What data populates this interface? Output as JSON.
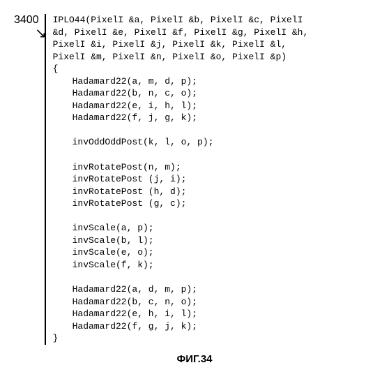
{
  "label": "3400",
  "caption": "ФИГ.34",
  "code": {
    "sig1": "IPLO44(PixelI &a, PixelI &b, PixelI &c, PixelI",
    "sig2": "&d, PixelI &e, PixelI &f, PixelI &g, PixelI &h,",
    "sig3": "PixelI &i, PixelI &j, PixelI &k, PixelI &l,",
    "sig4": "PixelI &m, PixelI &n, PixelI &o, PixelI &p)",
    "brace_open": "{",
    "h1": "Hadamard22(a, m, d, p);",
    "h2": "Hadamard22(b, n, c, o);",
    "h3": "Hadamard22(e, i, h, l);",
    "h4": "Hadamard22(f, j, g, k);",
    "iop": "invOddOddPost(k, l, o, p);",
    "r1": "invRotatePost(n, m);",
    "r2": "invRotatePost (j, i);",
    "r3": "invRotatePost (h, d);",
    "r4": "invRotatePost (g, c);",
    "s1": "invScale(a, p);",
    "s2": "invScale(b, l);",
    "s3": "invScale(e, o);",
    "s4": "invScale(f, k);",
    "hb1": "Hadamard22(a, d, m, p);",
    "hb2": "Hadamard22(b, c, n, o);",
    "hb3": "Hadamard22(e, h, i, l);",
    "hb4": "Hadamard22(f, g, j, k);",
    "brace_close": "}"
  }
}
